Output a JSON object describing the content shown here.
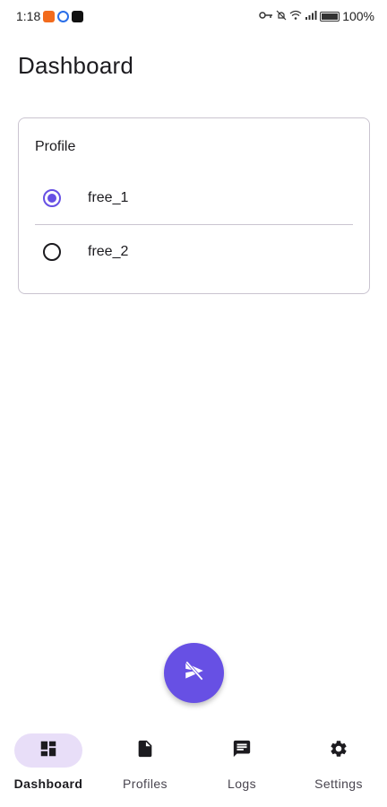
{
  "status_bar": {
    "time": "1:18",
    "battery_percent": "100%"
  },
  "header": {
    "title": "Dashboard"
  },
  "profile_card": {
    "title": "Profile",
    "options": [
      {
        "label": "free_1",
        "selected": true
      },
      {
        "label": "free_2",
        "selected": false
      }
    ]
  },
  "fab": {
    "icon": "send-off-icon"
  },
  "bottom_nav": {
    "items": [
      {
        "label": "Dashboard",
        "icon": "dashboard-icon",
        "active": true
      },
      {
        "label": "Profiles",
        "icon": "file-icon",
        "active": false
      },
      {
        "label": "Logs",
        "icon": "message-icon",
        "active": false
      },
      {
        "label": "Settings",
        "icon": "gear-icon",
        "active": false
      }
    ]
  },
  "colors": {
    "accent": "#6750e4",
    "active_nav_bg": "#e8def8",
    "border": "#cac4d0"
  }
}
